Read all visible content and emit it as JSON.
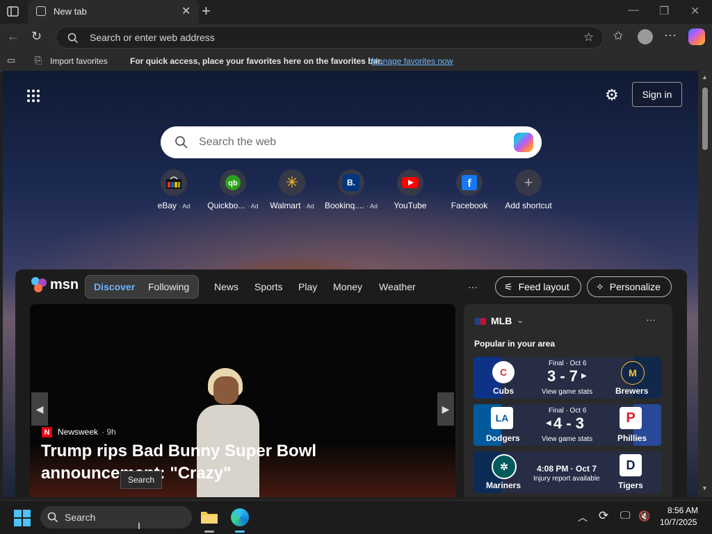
{
  "tab": {
    "title": "New tab"
  },
  "address_bar": {
    "placeholder": "Search or enter web address"
  },
  "favorites_bar": {
    "import_label": "Import favorites",
    "message": "For quick access, place your favorites here on the favorites bar.",
    "manage_link": "Manage favorites now"
  },
  "newtab": {
    "sign_in": "Sign in",
    "search_placeholder": "Search the web",
    "shortcuts": [
      {
        "label": "eBay",
        "ad": "· Ad",
        "icon": "ebay-icon"
      },
      {
        "label": "Quickbo...",
        "ad": "· Ad",
        "icon": "quickbooks-icon"
      },
      {
        "label": "Walmart",
        "ad": "· Ad",
        "icon": "walmart-icon"
      },
      {
        "label": "Bookinq....",
        "ad": "· Ad",
        "icon": "booking-icon"
      },
      {
        "label": "YouTube",
        "ad": "",
        "icon": "youtube-icon"
      },
      {
        "label": "Facebook",
        "ad": "",
        "icon": "facebook-icon"
      },
      {
        "label": "Add shortcut",
        "ad": "",
        "icon": "plus-icon"
      }
    ]
  },
  "msn": {
    "logo": "msn",
    "tabs": [
      "Discover",
      "Following"
    ],
    "nav": [
      "News",
      "Sports",
      "Play",
      "Money",
      "Weather"
    ],
    "more": "···",
    "feed_layout": "Feed layout",
    "personalize": "Personalize",
    "hero": {
      "source": "Newsweek",
      "age": "· 9h",
      "headline": "Trump rips Bad Bunny Super Bowl announcement: \"Crazy\""
    },
    "mlb": {
      "title": "MLB",
      "subtitle": "Popular in your area",
      "more": "···",
      "games": [
        {
          "status": "Final · Oct 6",
          "score": "3 - 7",
          "link": "View game stats",
          "home": "Cubs",
          "away": "Brewers"
        },
        {
          "status": "Final · Oct 6",
          "score": "4 - 3",
          "link": "View game stats",
          "home": "Dodgers",
          "away": "Phillies"
        },
        {
          "status": "4:08 PM · Oct 7",
          "score": "",
          "link": "Injury report available",
          "home": "Mariners",
          "away": "Tigers"
        }
      ]
    }
  },
  "tooltip": "Search",
  "taskbar": {
    "search_label": "Search",
    "time": "8:56 AM",
    "date": "10/7/2025"
  },
  "colors": {
    "link": "#6cb4ff",
    "accent": "#60cdff"
  }
}
